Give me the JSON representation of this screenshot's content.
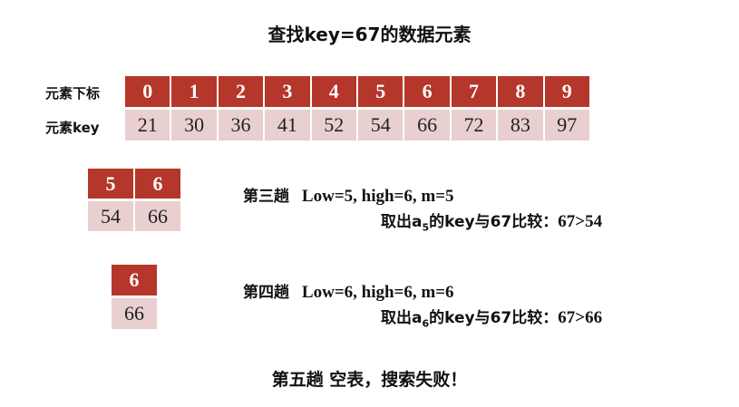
{
  "title": "查找key=67的数据元素",
  "table": {
    "index_label": "元素下标",
    "key_label": "元素key",
    "indices": [
      "0",
      "1",
      "2",
      "3",
      "4",
      "5",
      "6",
      "7",
      "8",
      "9"
    ],
    "keys": [
      "21",
      "30",
      "36",
      "41",
      "52",
      "54",
      "66",
      "72",
      "83",
      "97"
    ]
  },
  "step3": {
    "indices": [
      "5",
      "6"
    ],
    "keys": [
      "54",
      "66"
    ],
    "line1_label": "第三趟",
    "line1_params": "Low=5, high=6, m=5",
    "line2_prefix": "取出a",
    "line2_sub": "5",
    "line2_suffix": "的key与67比较：",
    "line2_result": "67>54"
  },
  "step4": {
    "indices": [
      "6"
    ],
    "keys": [
      "66"
    ],
    "line1_label": "第四趟",
    "line1_params": "Low=6, high=6, m=6",
    "line2_prefix": "取出a",
    "line2_sub": "6",
    "line2_suffix": "的key与67比较：",
    "line2_result": "67>66"
  },
  "step5": {
    "text": "第五趟 空表，搜索失败！"
  }
}
